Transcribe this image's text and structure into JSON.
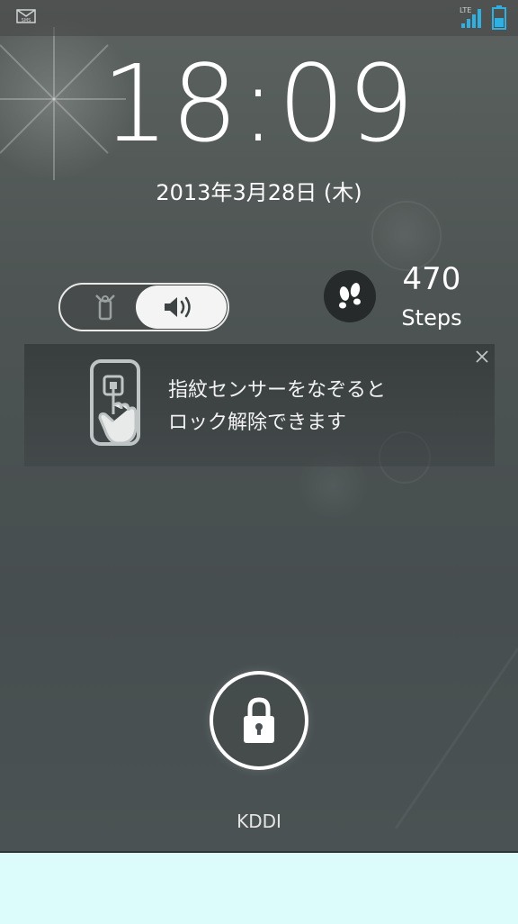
{
  "status_bar": {
    "left_icons": [
      "sms-icon"
    ],
    "right_icons": [
      "lte-signal-icon",
      "battery-icon"
    ],
    "network_label": "LTE"
  },
  "lockscreen": {
    "time": "18:09",
    "date": "2013年3月28日 (木)"
  },
  "sound_mode": {
    "options": [
      "vibrate-icon",
      "speaker-icon"
    ],
    "selected": "speaker-icon"
  },
  "pedometer": {
    "icon": "footprints-icon",
    "count": "470",
    "unit": "Steps"
  },
  "notice": {
    "line1": "指紋センサーをなぞると",
    "line2": "ロック解除できます",
    "icon": "fingerprint-swipe-icon"
  },
  "unlock": {
    "icon": "lock-icon"
  },
  "carrier": {
    "name": "KDDI"
  },
  "colors": {
    "accent": "#2fb0e0",
    "background": "#4d5453",
    "bottom_strip": "#dcfbfb"
  }
}
